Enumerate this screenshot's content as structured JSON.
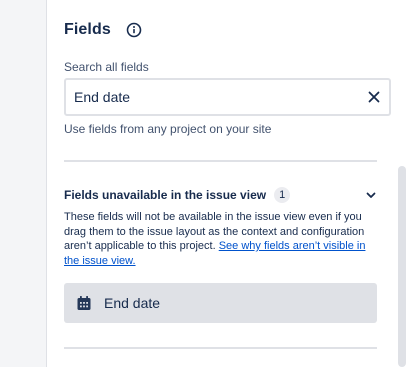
{
  "panel": {
    "title": "Fields",
    "info_icon": "info-icon"
  },
  "search": {
    "label": "Search all fields",
    "value": "End date",
    "clear_icon": "close-icon"
  },
  "helper_text": "Use fields from any project on your site",
  "unavailable_section": {
    "title": "Fields unavailable in the issue view",
    "count": "1",
    "chevron_icon": "chevron-down-icon",
    "description": "These fields will not be available in the issue view even if you drag them to the issue layout as the context and configuration aren’t applicable to this project.",
    "link_text": "See why fields aren’t visible in the issue view.",
    "fields": [
      {
        "label": "End date",
        "icon": "calendar-icon"
      }
    ]
  },
  "colors": {
    "link": "#0052cc",
    "text": "#172b4d",
    "subtle_text": "#42526e",
    "field_item_bg": "#dfe1e6"
  }
}
